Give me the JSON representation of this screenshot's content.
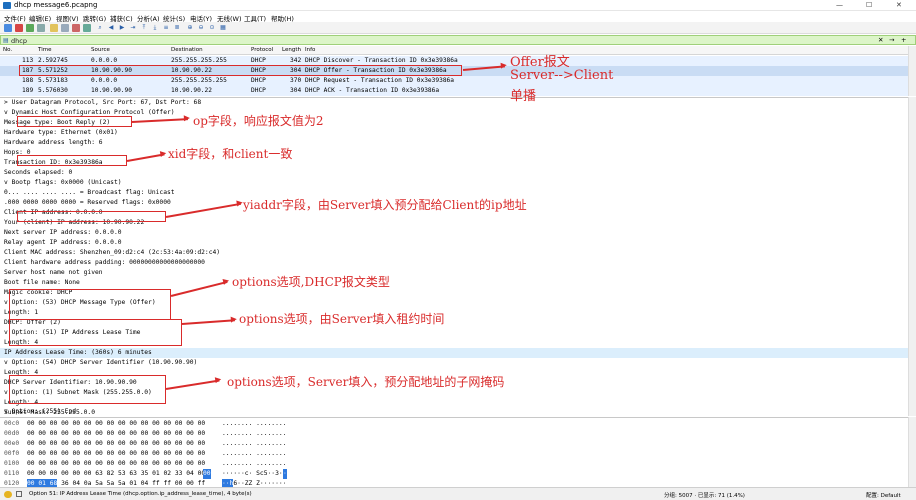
{
  "window": {
    "title": "dhcp message6.pcapng",
    "min": "—",
    "max": "☐",
    "close": "✕"
  },
  "menu": [
    "文件(F)",
    "编辑(E)",
    "视图(V)",
    "跳转(G)",
    "捕获(C)",
    "分析(A)",
    "统计(S)",
    "电话(Y)",
    "无线(W)",
    "工具(T)",
    "帮助(H)"
  ],
  "filter": {
    "value": "dhcp",
    "plus": "+"
  },
  "packet_list": {
    "columns": [
      "No.",
      "Time",
      "Source",
      "Destination",
      "Protocol",
      "Length",
      "Info"
    ],
    "rows": [
      {
        "no": "113",
        "time": "2.592745",
        "src": "0.0.0.0",
        "dst": "255.255.255.255",
        "proto": "DHCP",
        "len": "342",
        "info": "DHCP Discover - Transaction ID 0x3e39386a"
      },
      {
        "no": "187",
        "time": "5.571252",
        "src": "10.90.90.90",
        "dst": "10.90.90.22",
        "proto": "DHCP",
        "len": "304",
        "info": "DHCP Offer    - Transaction ID 0x3e39386a"
      },
      {
        "no": "188",
        "time": "5.573183",
        "src": "0.0.0.0",
        "dst": "255.255.255.255",
        "proto": "DHCP",
        "len": "370",
        "info": "DHCP Request  - Transaction ID 0x3e39386a"
      },
      {
        "no": "189",
        "time": "5.576030",
        "src": "10.90.90.90",
        "dst": "10.90.90.22",
        "proto": "DHCP",
        "len": "304",
        "info": "DHCP ACK      - Transaction ID 0x3e39386a"
      }
    ]
  },
  "details": [
    "> User Datagram Protocol, Src Port: 67, Dst Port: 68",
    "v Dynamic Host Configuration Protocol (Offer)",
    "    Message type: Boot Reply (2)",
    "    Hardware type: Ethernet (0x01)",
    "    Hardware address length: 6",
    "    Hops: 0",
    "    Transaction ID: 0x3e39386a",
    "    Seconds elapsed: 0",
    "  v Bootp flags: 0x0000 (Unicast)",
    "      0... .... .... .... = Broadcast flag: Unicast",
    "      .000 0000 0000 0000 = Reserved flags: 0x0000",
    "    Client IP address: 0.0.0.0",
    "    Your (client) IP address: 10.90.90.22",
    "    Next server IP address: 0.0.0.0",
    "    Relay agent IP address: 0.0.0.0",
    "    Client MAC address: Shenzhen_09:d2:c4 (2c:53:4a:09:d2:c4)",
    "    Client hardware address padding: 00000000000000000000",
    "    Server host name not given",
    "    Boot file name: None",
    "    Magic cookie: DHCP",
    "  v Option: (53) DHCP Message Type (Offer)",
    "      Length: 1",
    "      DHCP: Offer (2)",
    "  v Option: (51) IP Address Lease Time",
    "      Length: 4",
    "      IP Address Lease Time: (360s) 6 minutes",
    "  v Option: (54) DHCP Server Identifier (10.90.90.90)",
    "      Length: 4",
    "      DHCP Server Identifier: 10.90.90.90",
    "  v Option: (1) Subnet Mask (255.255.0.0)",
    "      Length: 4",
    "      Subnet Mask: 255.255.0.0",
    "  v Option: (255) End"
  ],
  "hex": [
    {
      "off": "00c0",
      "bytes": "00 00 00 00 00 00 00 00  00 00 00 00 00 00 00 00",
      "ascii": "........ ........"
    },
    {
      "off": "00d0",
      "bytes": "00 00 00 00 00 00 00 00  00 00 00 00 00 00 00 00",
      "ascii": "........ ........"
    },
    {
      "off": "00e0",
      "bytes": "00 00 00 00 00 00 00 00  00 00 00 00 00 00 00 00",
      "ascii": "........ ........"
    },
    {
      "off": "00f0",
      "bytes": "00 00 00 00 00 00 00 00  00 00 00 00 00 00 00 00",
      "ascii": "........ ........"
    },
    {
      "off": "0100",
      "bytes": "00 00 00 00 00 00 00 00  00 00 00 00 00 00 00 00",
      "ascii": "........ ........"
    },
    {
      "off": "0110",
      "bytes": "00 00 00 00 00 00 63 82  53 63 35 01 02 33 04 00",
      "ascii": "······c· Sc5··3··"
    },
    {
      "off": "0120",
      "bytes": "00 01 68 36 04 0a 5a 5a  5a 01 04 ff ff 00 00 ff",
      "ascii": "··h6··ZZ Z·······"
    }
  ],
  "hex_sel": {
    "r5": "00",
    "r6": "00 01 68",
    "a5": "·",
    "a6": "··h"
  },
  "status": {
    "left": "Option 51: IP Address Lease Time (dhcp.option.ip_address_lease_time), 4 byte(s)",
    "right": "分组: 5007 · 已显示: 71 (1.4%)",
    "profile": "配置: Default"
  },
  "annotations": {
    "offer": "Offer报文",
    "offer2": "Server-->Client",
    "offer3": "单播",
    "op": "op字段，响应报文值为2",
    "xid": "xid字段，和client一致",
    "yiaddr": "yiaddr字段，由Server填入预分配给Client的ip地址",
    "opt53": "options选项,DHCP报文类型",
    "opt51": "options选项，由Server填入租约时间",
    "opt1": "options选项，Server填入，预分配地址的子网掩码"
  },
  "colors": {
    "accent_red": "#d92b2b",
    "selected_row": "#dbeefc",
    "filter_bg": "#dcf5c8"
  }
}
